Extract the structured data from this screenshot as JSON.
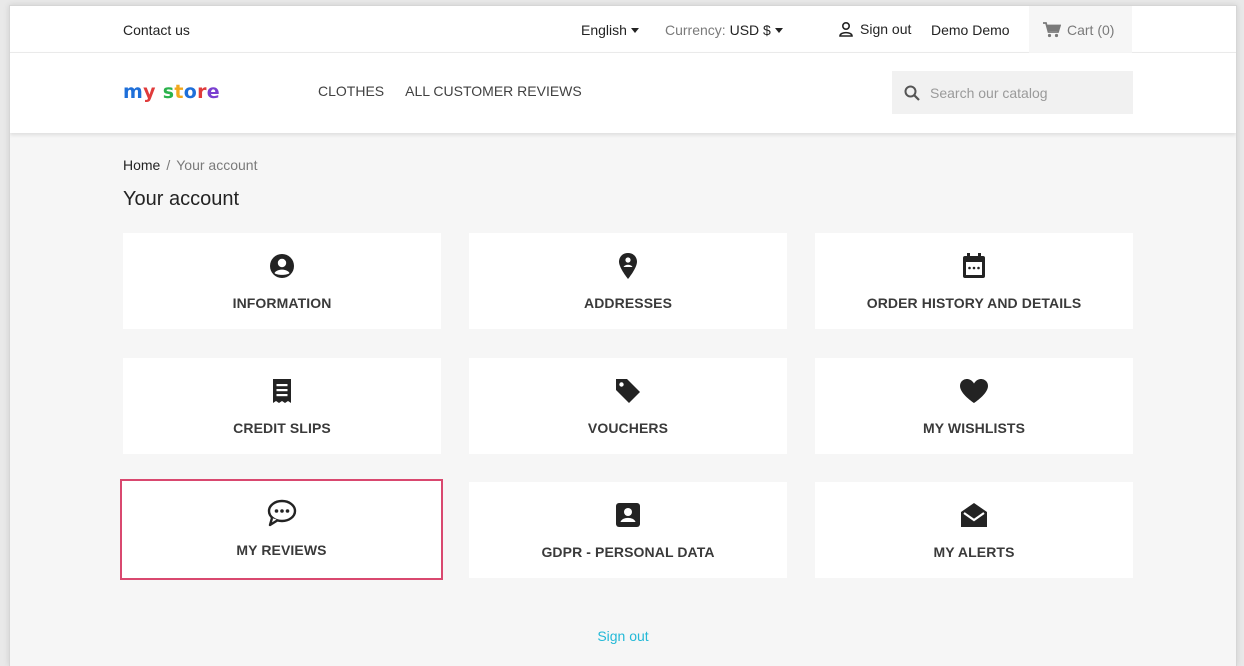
{
  "topbar": {
    "contact": "Contact us",
    "language": "English",
    "currency_label": "Currency:",
    "currency_value": "USD $",
    "sign_out": "Sign out",
    "username": "Demo Demo",
    "cart": "Cart (0)"
  },
  "header": {
    "logo": [
      "m",
      "y",
      " ",
      "s",
      "t",
      "o",
      "r",
      "e"
    ],
    "logo_colors": [
      "#1e6fd9",
      "#e03b3b",
      "#ffffff",
      "#2bb24c",
      "#f2a81d",
      "#1e6fd9",
      "#e03b3b",
      "#7a3fd0"
    ],
    "nav": [
      "CLOTHES",
      "ALL CUSTOMER REVIEWS"
    ],
    "search_placeholder": "Search our catalog"
  },
  "breadcrumb": {
    "home": "Home",
    "separator": "/",
    "current": "Your account"
  },
  "page_title": "Your account",
  "tiles": [
    {
      "label": "INFORMATION",
      "icon": "account-circle-icon"
    },
    {
      "label": "ADDRESSES",
      "icon": "location-pin-icon"
    },
    {
      "label": "ORDER HISTORY AND DETAILS",
      "icon": "calendar-icon"
    },
    {
      "label": "CREDIT SLIPS",
      "icon": "receipt-icon"
    },
    {
      "label": "VOUCHERS",
      "icon": "tag-icon"
    },
    {
      "label": "MY WISHLISTS",
      "icon": "heart-icon"
    },
    {
      "label": "MY REVIEWS",
      "icon": "chat-bubble-icon",
      "highlighted": true
    },
    {
      "label": "GDPR - PERSONAL DATA",
      "icon": "contact-card-icon"
    },
    {
      "label": "MY ALERTS",
      "icon": "open-envelope-icon"
    }
  ],
  "footer": {
    "sign_out": "Sign out"
  },
  "colors": {
    "link": "#24b9d7",
    "highlight_border": "#d9486f",
    "icon": "#232323"
  }
}
